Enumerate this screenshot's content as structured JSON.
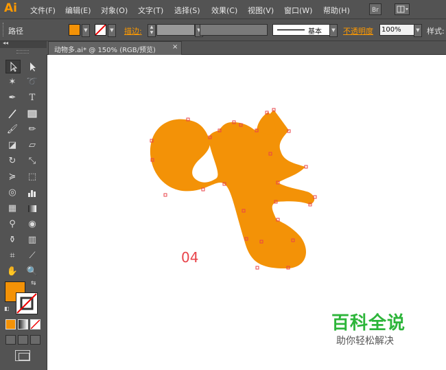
{
  "app": {
    "logo": "Ai"
  },
  "menu": [
    "文件(F)",
    "编辑(E)",
    "对象(O)",
    "文字(T)",
    "选择(S)",
    "效果(C)",
    "视图(V)",
    "窗口(W)",
    "帮助(H)"
  ],
  "menu_icons": [
    "bridge-icon",
    "arrange-documents-icon"
  ],
  "control": {
    "selection_label": "路径",
    "stroke_label": "描边:",
    "brush_style": "基本",
    "opacity_label": "不透明度",
    "opacity_value": "100%",
    "style_label": "样式:"
  },
  "document_tab": {
    "title": "动物多.ai* @ 150% (RGB/预览)",
    "close": "×"
  },
  "canvas": {
    "label": "04",
    "shape_fill": "#f39207",
    "anchor_color": "#e8434a"
  },
  "watermark": {
    "title": "百科全说",
    "subtitle": "助你轻松解决"
  },
  "colors": {
    "accent": "#ff9a00",
    "fill": "#f39207",
    "watermark_green": "#2db53a",
    "label_red": "#e8434a"
  }
}
